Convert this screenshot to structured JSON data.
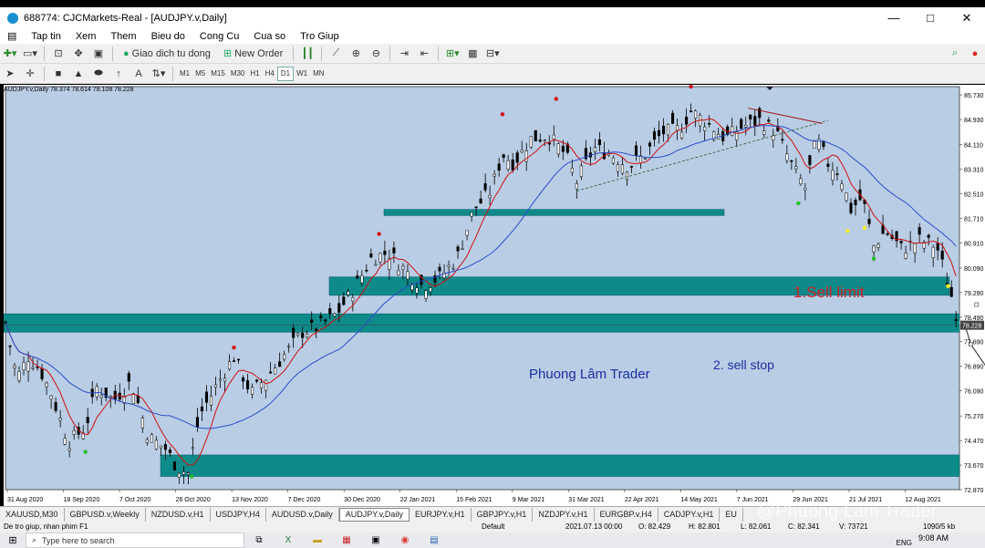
{
  "window": {
    "title": "688774: CJCMarkets-Real - [AUDJPY.v,Daily]",
    "minimize": "—",
    "maximize": "□",
    "close": "✕"
  },
  "menu": [
    "Tap tin",
    "Xem",
    "Them",
    "Bieu do",
    "Cong Cu",
    "Cua so",
    "Tro Giup"
  ],
  "toolbar": {
    "autotrade_label": "Giao dich tu dong",
    "new_order_label": "New Order"
  },
  "timeframes": [
    "M1",
    "M5",
    "M15",
    "M30",
    "H1",
    "H4",
    "D1",
    "W1",
    "MN"
  ],
  "active_timeframe": "D1",
  "chart_header": "AUDJPY.v,Daily  78.374 78.614 78.108 78.228",
  "annotations": {
    "sell_limit": "1.Sell limit",
    "sell_stop": "2. sell stop",
    "author": "Phuong Lâm Trader",
    "watermark": "@Phuong Lâm Trader"
  },
  "tabs": [
    "XAUUSD,M30",
    "GBPUSD.v,Weekly",
    "NZDUSD.v,H1",
    "USDJPY,H4",
    "AUDUSD.v,Daily",
    "AUDJPY.v,Daily",
    "EURJPY.v,H1",
    "GBPJPY.v,H1",
    "NZDJPY.v,H1",
    "EURGBP.v,H4",
    "CADJPY.v,H1",
    "EU"
  ],
  "active_tab": "AUDJPY.v,Daily",
  "status": {
    "help": "De tro giup, nhan phim F1",
    "profile": "Default",
    "datetime": "2021.07.13 00:00",
    "open": "O: 82.429",
    "high": "H: 82.801",
    "low": "L: 82.061",
    "close": "C: 82.341",
    "volume": "V: 73721",
    "traffic": "1090/5 kb"
  },
  "taskbar": {
    "search_placeholder": "Type here to search",
    "time": "9:08 AM",
    "lang": "ENG"
  },
  "colors": {
    "chart_bg": "#b9cde5",
    "zone": "#0e8a8a",
    "ma_fast": "#d01010",
    "ma_slow": "#2b4fc8",
    "candle": "#000000"
  },
  "chart_data": {
    "type": "candlestick",
    "symbol": "AUDJPY.v",
    "timeframe": "Daily",
    "y_ticks": [
      "85.730",
      "84.930",
      "84.110",
      "83.310",
      "82.510",
      "81.710",
      "80.910",
      "80.090",
      "79.290",
      "78.490",
      "77.690",
      "76.890",
      "76.090",
      "75.270",
      "74.470",
      "73.670",
      "72.870"
    ],
    "current_price": "78.228",
    "ylim": [
      72.87,
      86.0
    ],
    "x_ticks": [
      "31 Aug 2020",
      "18 Sep 2020",
      "7 Oct 2020",
      "26 Oct 2020",
      "13 Nov 2020",
      "7 Dec 2020",
      "30 Dec 2020",
      "22 Jan 2021",
      "15 Feb 2021",
      "9 Mar 2021",
      "31 Mar 2021",
      "22 Apr 2021",
      "14 May 2021",
      "7 Jun 2021",
      "29 Jun 2021",
      "21 Jul 2021",
      "12 Aug 2021"
    ],
    "close_path": [
      [
        0,
        78.3
      ],
      [
        10,
        76.5
      ],
      [
        20,
        77.2
      ],
      [
        30,
        76.8
      ],
      [
        40,
        76.0
      ],
      [
        55,
        74.4
      ],
      [
        70,
        74.9
      ],
      [
        80,
        76.2
      ],
      [
        95,
        75.8
      ],
      [
        110,
        76.4
      ],
      [
        125,
        74.6
      ],
      [
        140,
        74.2
      ],
      [
        150,
        73.6
      ],
      [
        160,
        73.4
      ],
      [
        170,
        75.3
      ],
      [
        190,
        76.6
      ],
      [
        200,
        77.2
      ],
      [
        215,
        76.0
      ],
      [
        230,
        76.6
      ],
      [
        245,
        77.3
      ],
      [
        260,
        78.0
      ],
      [
        275,
        78.2
      ],
      [
        290,
        78.6
      ],
      [
        305,
        79.4
      ],
      [
        320,
        80.4
      ],
      [
        335,
        80.6
      ],
      [
        350,
        80.0
      ],
      [
        365,
        79.5
      ],
      [
        380,
        79.8
      ],
      [
        395,
        80.4
      ],
      [
        410,
        82.0
      ],
      [
        425,
        82.6
      ],
      [
        435,
        83.8
      ],
      [
        445,
        83.5
      ],
      [
        460,
        84.3
      ],
      [
        475,
        84.4
      ],
      [
        490,
        83.8
      ],
      [
        500,
        82.9
      ],
      [
        515,
        84.0
      ],
      [
        530,
        83.8
      ],
      [
        545,
        83.4
      ],
      [
        560,
        83.8
      ],
      [
        575,
        84.5
      ],
      [
        590,
        84.6
      ],
      [
        600,
        85.2
      ],
      [
        615,
        84.8
      ],
      [
        630,
        84.3
      ],
      [
        645,
        84.7
      ],
      [
        660,
        84.9
      ],
      [
        675,
        84.5
      ],
      [
        690,
        83.3
      ],
      [
        700,
        82.7
      ],
      [
        710,
        84.3
      ],
      [
        720,
        83.5
      ],
      [
        730,
        83.2
      ],
      [
        740,
        82.0
      ],
      [
        750,
        82.4
      ],
      [
        760,
        80.8
      ],
      [
        770,
        81.3
      ],
      [
        785,
        80.7
      ],
      [
        800,
        81.0
      ],
      [
        815,
        80.8
      ],
      [
        825,
        79.6
      ],
      [
        835,
        78.2
      ]
    ],
    "zones": [
      {
        "label": "resistance-1",
        "top": 82.0,
        "bottom": 81.8
      },
      {
        "label": "sell-limit-zone",
        "top": 79.8,
        "bottom": 79.2
      },
      {
        "label": "current-zone",
        "top": 78.6,
        "bottom": 78.0
      },
      {
        "label": "target-zone",
        "top": 74.0,
        "bottom": 73.3
      }
    ]
  }
}
